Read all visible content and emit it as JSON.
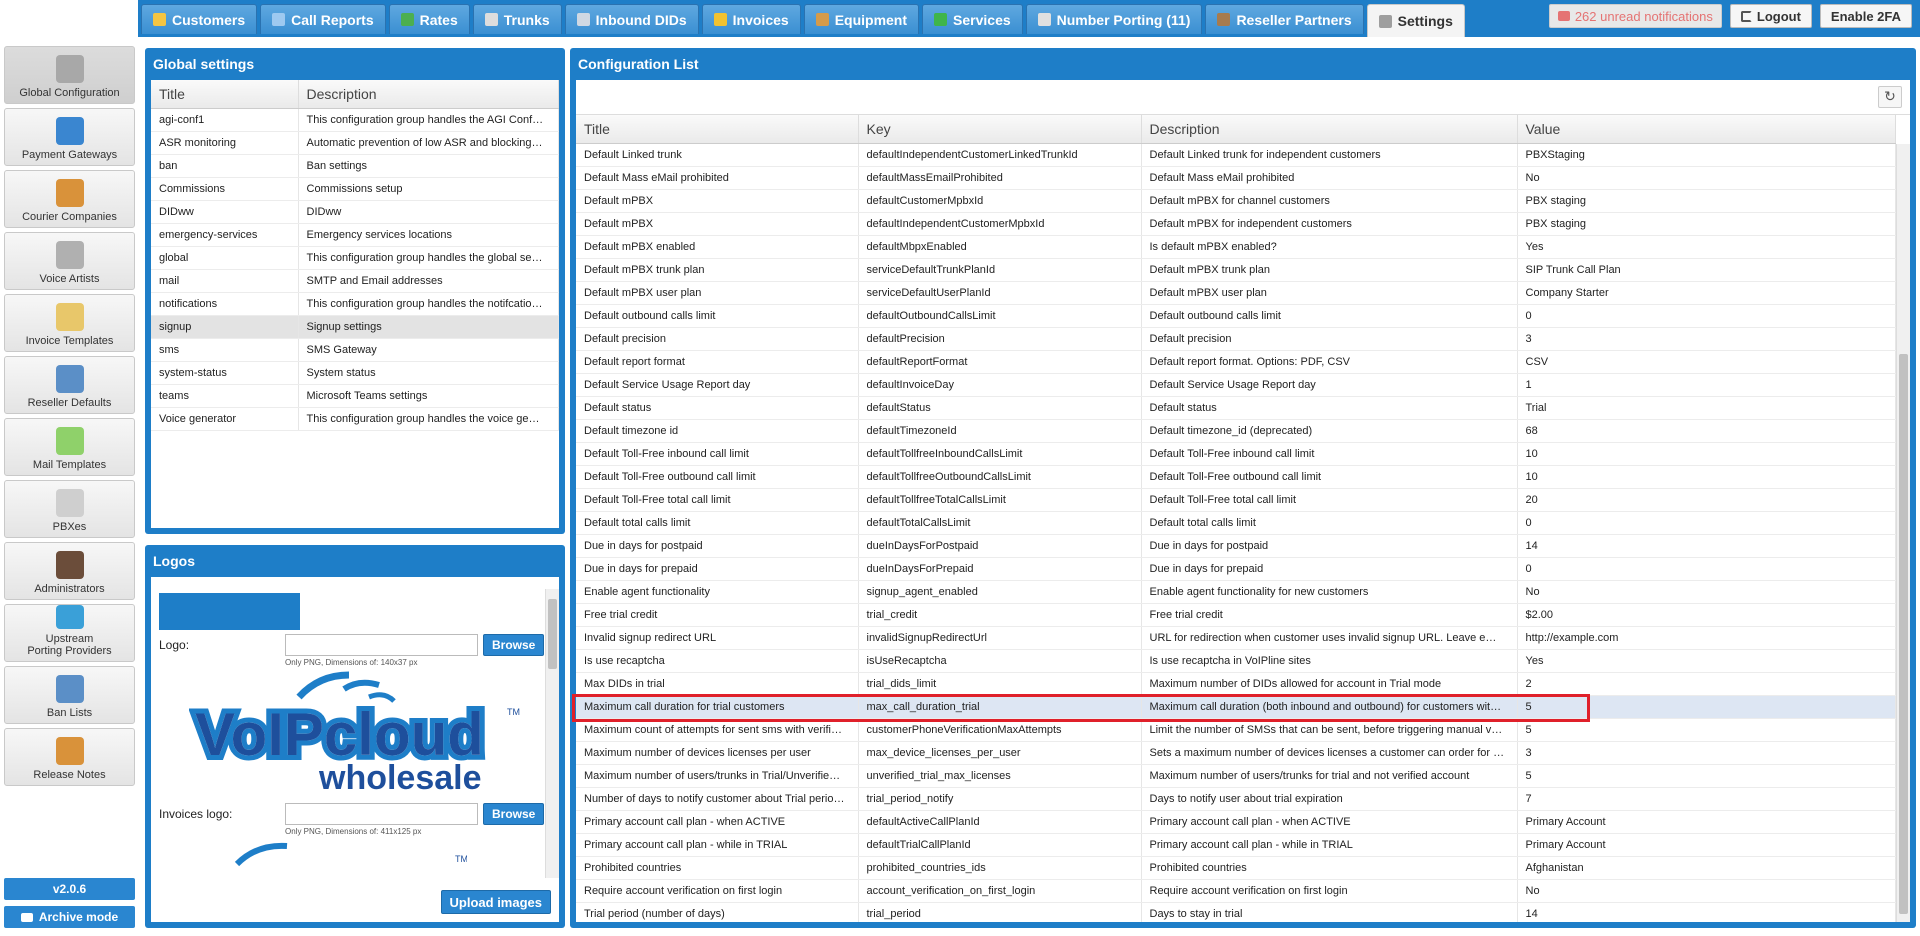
{
  "nav": {
    "tabs": [
      {
        "label": "Customers",
        "icon": "customers-icon",
        "color": "#f5c542"
      },
      {
        "label": "Call Reports",
        "icon": "call-reports-icon",
        "color": "#9ec9f0"
      },
      {
        "label": "Rates",
        "icon": "rates-icon",
        "color": "#4caf50"
      },
      {
        "label": "Trunks",
        "icon": "trunks-icon",
        "color": "#dddddd"
      },
      {
        "label": "Inbound DIDs",
        "icon": "inbound-dids-icon",
        "color": "#cfd8e3"
      },
      {
        "label": "Invoices",
        "icon": "invoices-icon",
        "color": "#f2c230"
      },
      {
        "label": "Equipment",
        "icon": "equipment-icon",
        "color": "#d59b4a"
      },
      {
        "label": "Services",
        "icon": "services-icon",
        "color": "#3fb54a"
      },
      {
        "label": "Number Porting (11)",
        "icon": "number-porting-icon",
        "color": "#e0e0e0"
      },
      {
        "label": "Reseller Partners",
        "icon": "reseller-partners-icon",
        "color": "#a77b4e"
      },
      {
        "label": "Settings",
        "icon": "settings-icon",
        "color": "#9e9e9e"
      }
    ],
    "notifications": "262 unread notifications",
    "logout": "Logout",
    "enable2fa": "Enable 2FA"
  },
  "sidebar": {
    "items": [
      {
        "label": "Global Configuration",
        "icon": "gears-icon",
        "color": "#a8a8a8"
      },
      {
        "label": "Payment Gateways",
        "icon": "payment-gateways-icon",
        "color": "#3a86d0"
      },
      {
        "label": "Courier Companies",
        "icon": "box-icon",
        "color": "#d9923a"
      },
      {
        "label": "Voice Artists",
        "icon": "megaphone-icon",
        "color": "#b0b0b0"
      },
      {
        "label": "Invoice Templates",
        "icon": "invoice-template-icon",
        "color": "#e8c76a"
      },
      {
        "label": "Reseller Defaults",
        "icon": "users-gear-icon",
        "color": "#5b8fc7"
      },
      {
        "label": "Mail Templates",
        "icon": "envelope-icon",
        "color": "#8fd16a"
      },
      {
        "label": "PBXes",
        "icon": "pbx-icon",
        "color": "#cfcfcf"
      },
      {
        "label": "Administrators",
        "icon": "administrator-icon",
        "color": "#6b4d3a"
      },
      {
        "label": "Upstream\nPorting Providers",
        "icon": "porting-providers-icon",
        "color": "#3aa0d8"
      },
      {
        "label": "Ban Lists",
        "icon": "ban-lists-icon",
        "color": "#5b8fc7"
      },
      {
        "label": "Release Notes",
        "icon": "release-notes-icon",
        "color": "#d9923a"
      }
    ],
    "version": "v2.0.6",
    "archive": "Archive mode"
  },
  "global_settings": {
    "title": "Global settings",
    "columns": [
      "Title",
      "Description"
    ],
    "rows": [
      {
        "title": "agi-conf1",
        "description": "This configuration group handles the AGI Conf…"
      },
      {
        "title": "ASR monitoring",
        "description": "Automatic prevention of low ASR and blocking…"
      },
      {
        "title": "ban",
        "description": "Ban settings"
      },
      {
        "title": "Commissions",
        "description": "Commissions setup"
      },
      {
        "title": "DIDww",
        "description": "DIDww"
      },
      {
        "title": "emergency-services",
        "description": "Emergency services locations"
      },
      {
        "title": "global",
        "description": "This configuration group handles the global se…"
      },
      {
        "title": "mail",
        "description": "SMTP and Email addresses"
      },
      {
        "title": "notifications",
        "description": "This configuration group handles the notifcatio…"
      },
      {
        "title": "signup",
        "description": "Signup settings",
        "selected": true
      },
      {
        "title": "sms",
        "description": "SMS Gateway"
      },
      {
        "title": "system-status",
        "description": "System status"
      },
      {
        "title": "teams",
        "description": "Microsoft Teams settings"
      },
      {
        "title": "Voice generator",
        "description": "This configuration group handles the voice ge…"
      }
    ]
  },
  "logos": {
    "title": "Logos",
    "logo_label": "Logo:",
    "logo_hint": "Only PNG, Dimensions of: 140x37 px",
    "invoices_logo_label": "Invoices logo:",
    "invoices_logo_hint": "Only PNG, Dimensions of: 411x125 px",
    "browse": "Browse",
    "upload": "Upload images",
    "brand_word1": "VoIPcloud",
    "brand_word2": "wholesale",
    "brand_tm": "TM",
    "brand_color": "#1e7ec8",
    "brand_dark": "#1e4f9c"
  },
  "config_list": {
    "title": "Configuration List",
    "columns": [
      "Title",
      "Key",
      "Description",
      "Value"
    ],
    "rows": [
      {
        "title": "Default Linked trunk",
        "key": "defaultIndependentCustomerLinkedTrunkId",
        "description": "Default Linked trunk for independent customers",
        "value": "PBXStaging"
      },
      {
        "title": "Default Mass eMail prohibited",
        "key": "defaultMassEmailProhibited",
        "description": "Default Mass eMail prohibited",
        "value": "No"
      },
      {
        "title": "Default mPBX",
        "key": "defaultCustomerMpbxId",
        "description": "Default mPBX for channel customers",
        "value": "PBX staging"
      },
      {
        "title": "Default mPBX",
        "key": "defaultIndependentCustomerMpbxId",
        "description": "Default mPBX for independent customers",
        "value": "PBX staging"
      },
      {
        "title": "Default mPBX enabled",
        "key": "defaultMbpxEnabled",
        "description": "Is default mPBX enabled?",
        "value": "Yes"
      },
      {
        "title": "Default mPBX trunk plan",
        "key": "serviceDefaultTrunkPlanId",
        "description": "Default mPBX trunk plan",
        "value": "SIP Trunk Call Plan"
      },
      {
        "title": "Default mPBX user plan",
        "key": "serviceDefaultUserPlanId",
        "description": "Default mPBX user plan",
        "value": "Company Starter"
      },
      {
        "title": "Default outbound calls limit",
        "key": "defaultOutboundCallsLimit",
        "description": "Default outbound calls limit",
        "value": "0"
      },
      {
        "title": "Default precision",
        "key": "defaultPrecision",
        "description": "Default precision",
        "value": "3"
      },
      {
        "title": "Default report format",
        "key": "defaultReportFormat",
        "description": "Default report format. Options: PDF, CSV",
        "value": "CSV"
      },
      {
        "title": "Default Service Usage Report day",
        "key": "defaultInvoiceDay",
        "description": "Default Service Usage Report day",
        "value": "1"
      },
      {
        "title": "Default status",
        "key": "defaultStatus",
        "description": "Default status",
        "value": "Trial"
      },
      {
        "title": "Default timezone id",
        "key": "defaultTimezoneId",
        "description": "Default timezone_id (deprecated)",
        "value": "68"
      },
      {
        "title": "Default Toll-Free inbound call limit",
        "key": "defaultTollfreeInboundCallsLimit",
        "description": "Default Toll-Free inbound call limit",
        "value": "10"
      },
      {
        "title": "Default Toll-Free outbound call limit",
        "key": "defaultTollfreeOutboundCallsLimit",
        "description": "Default Toll-Free outbound call limit",
        "value": "10"
      },
      {
        "title": "Default Toll-Free total call limit",
        "key": "defaultTollfreeTotalCallsLimit",
        "description": "Default Toll-Free total call limit",
        "value": "20"
      },
      {
        "title": "Default total calls limit",
        "key": "defaultTotalCallsLimit",
        "description": "Default total calls limit",
        "value": "0"
      },
      {
        "title": "Due in days for postpaid",
        "key": "dueInDaysForPostpaid",
        "description": "Due in days for postpaid",
        "value": "14"
      },
      {
        "title": "Due in days for prepaid",
        "key": "dueInDaysForPrepaid",
        "description": "Due in days for prepaid",
        "value": "0"
      },
      {
        "title": "Enable agent functionality",
        "key": "signup_agent_enabled",
        "description": "Enable agent functionality for new customers",
        "value": "No"
      },
      {
        "title": "Free trial credit",
        "key": "trial_credit",
        "description": "Free trial credit",
        "value": "$2.00"
      },
      {
        "title": "Invalid signup redirect URL",
        "key": "invalidSignupRedirectUrl",
        "description": "URL for redirection when customer uses invalid signup URL. Leave e…",
        "value": "http://example.com"
      },
      {
        "title": "Is use recaptcha",
        "key": "isUseRecaptcha",
        "description": "Is use recaptcha in VoIPline sites",
        "value": "Yes"
      },
      {
        "title": "Max DIDs in trial",
        "key": "trial_dids_limit",
        "description": "Maximum number of DIDs allowed for account in Trial mode",
        "value": "2"
      },
      {
        "title": "Maximum call duration for trial customers",
        "key": "max_call_duration_trial",
        "description": "Maximum call duration (both inbound and outbound) for customers wit…",
        "value": "5",
        "selected": true
      },
      {
        "title": "Maximum count of attempts for sent sms with verifi…",
        "key": "customerPhoneVerificationMaxAttempts",
        "description": "Limit the number of SMSs that can be sent, before triggering manual v…",
        "value": "5"
      },
      {
        "title": "Maximum number of devices licenses per user",
        "key": "max_device_licenses_per_user",
        "description": "Sets a maximum number of devices licenses a customer can order for …",
        "value": "3"
      },
      {
        "title": "Maximum number of users/trunks in Trial/Unverifie…",
        "key": "unverified_trial_max_licenses",
        "description": "Maximum number of users/trunks for trial and not verified account",
        "value": "5"
      },
      {
        "title": "Number of days to notify customer about Trial perio…",
        "key": "trial_period_notify",
        "description": "Days to notify user about trial expiration",
        "value": "7"
      },
      {
        "title": "Primary account call plan - when ACTIVE",
        "key": "defaultActiveCallPlanId",
        "description": "Primary account call plan - when ACTIVE",
        "value": "Primary Account"
      },
      {
        "title": "Primary account call plan - while in TRIAL",
        "key": "defaultTrialCallPlanId",
        "description": "Primary account call plan - while in TRIAL",
        "value": "Primary Account"
      },
      {
        "title": "Prohibited countries",
        "key": "prohibited_countries_ids",
        "description": "Prohibited countries",
        "value": "Afghanistan"
      },
      {
        "title": "Require account verification on first login",
        "key": "account_verification_on_first_login",
        "description": "Require account verification on first login",
        "value": "No"
      },
      {
        "title": "Trial period (number of days)",
        "key": "trial_period",
        "description": "Days to stay in trial",
        "value": "14"
      }
    ]
  },
  "colors": {
    "accent": "#1e7ec8",
    "highlight": "#e0202a",
    "selected_row": "#dde6f3"
  }
}
